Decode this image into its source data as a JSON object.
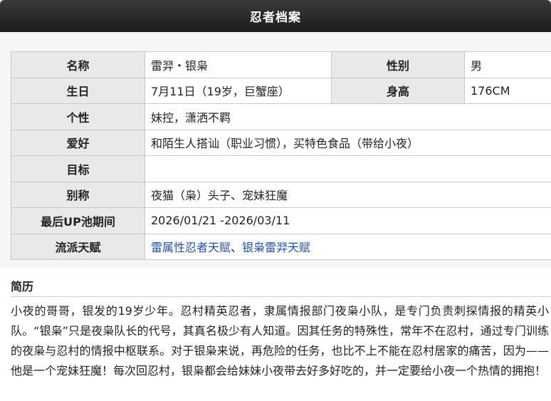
{
  "header": {
    "title": "忍者档案"
  },
  "profile": {
    "name_label": "名称",
    "name_value": "雷羿・银枭",
    "gender_label": "性别",
    "gender_value": "男",
    "birthday_label": "生日",
    "birthday_value": "7月11日（19岁，巨蟹座）",
    "height_label": "身高",
    "height_value": "176CM",
    "personality_label": "个性",
    "personality_value": "妹控，潇洒不羁",
    "hobby_label": "爱好",
    "hobby_value": "和陌生人搭讪（职业习惯），买特色食品（带给小夜）",
    "goal_label": "目标",
    "goal_value": "",
    "alias_label": "别称",
    "alias_value": "夜猫（枭）头子、宠妹狂魔",
    "pool_label": "最后UP池期间",
    "pool_value": "2026/01/21 -2026/03/11",
    "talent_label": "流派天赋",
    "talent_link_1": "雷属性忍者天赋",
    "talent_separator": "、",
    "talent_link_2": "银枭雷羿天赋"
  },
  "bio": {
    "title": "简历",
    "text": "小夜的哥哥，银发的19岁少年。忍村精英忍者，隶属情报部门夜枭小队，是专门负责刺探情报的精英小队。“银枭”只是夜枭队长的代号，其真名极少有人知道。因其任务的特殊性，常年不在忍村，通过专门训练的夜枭与忍村的情报中枢联系。对于银枭来说，再危险的任务，也比不上不能在忍村居家的痛苦，因为——他是一个宠妹狂魔！每次回忍村，银枭都会给妹妹小夜带去好多好吃的，并一定要给小夜一个热情的拥抱！"
  },
  "colors": {
    "header_bg": "#1c1c1c",
    "label_bg": "#e9e9e9",
    "link": "#1f4fae"
  }
}
